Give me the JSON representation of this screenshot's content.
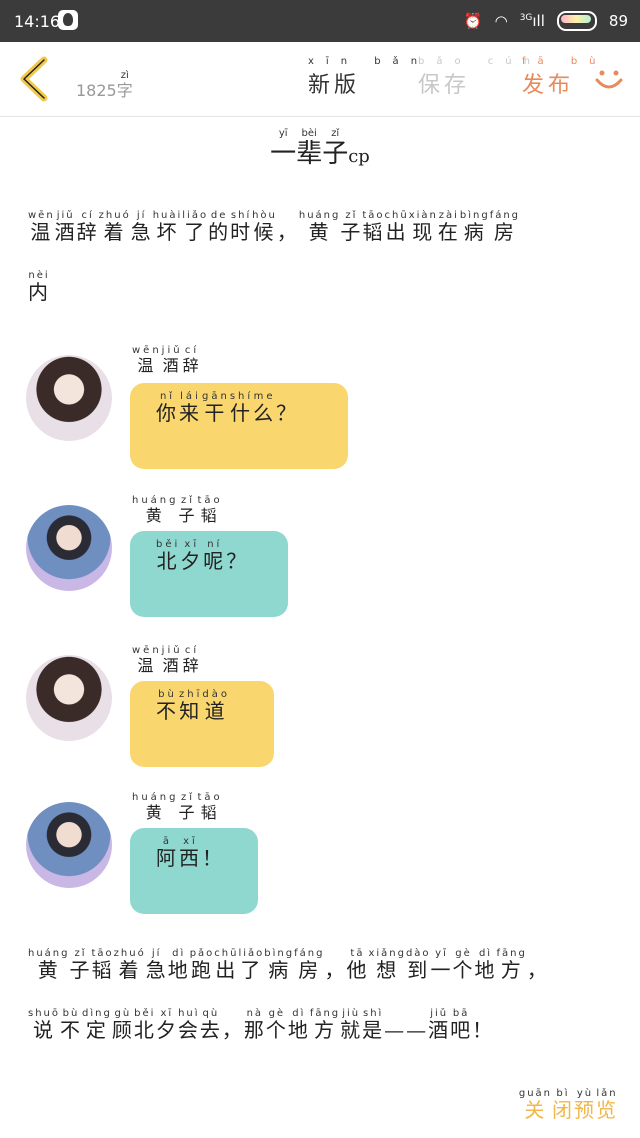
{
  "status_bar": {
    "time": "14:16",
    "signal": "3G",
    "battery": "89"
  },
  "toolbar": {
    "word_count": "1825",
    "word_unit": "字",
    "word_unit_py": "zì",
    "new_version": "新版",
    "new_version_py": "xīn bǎn",
    "save": "保存",
    "save_py": "bǎo cún",
    "publish": "发布",
    "publish_py": "fā bù"
  },
  "title": {
    "text": [
      [
        "一",
        "yī"
      ],
      [
        "辈",
        "bèi"
      ],
      [
        "子",
        "zǐ"
      ]
    ],
    "suffix": "cp"
  },
  "para1": {
    "line1": [
      [
        "温",
        "wēn"
      ],
      [
        "酒",
        "jiǔ"
      ],
      [
        "辞",
        "cí"
      ],
      [
        "着",
        "zhuó"
      ],
      [
        "急",
        "jí"
      ],
      [
        "坏",
        "huài"
      ],
      [
        "了",
        "liǎo"
      ],
      [
        "的",
        "de"
      ],
      [
        "时",
        "shí"
      ],
      [
        "候",
        "hòu"
      ],
      [
        "，",
        ""
      ],
      [
        "黄",
        "huáng"
      ],
      [
        "子",
        "zǐ"
      ],
      [
        "韬",
        "tāo"
      ],
      [
        "出",
        "chū"
      ],
      [
        "现",
        "xiàn"
      ],
      [
        "在",
        "zài"
      ],
      [
        "病",
        "bìng"
      ],
      [
        "房",
        "fáng"
      ]
    ],
    "line2": [
      [
        "内",
        "nèi"
      ]
    ]
  },
  "messages": [
    {
      "sender": [
        [
          "温",
          "wēn"
        ],
        [
          "酒",
          "jiǔ"
        ],
        [
          "辞",
          "cí"
        ]
      ],
      "text": [
        [
          "你",
          "nǐ"
        ],
        [
          "来",
          "lái"
        ],
        [
          "干",
          "gān"
        ],
        [
          "什",
          "shí"
        ],
        [
          "么",
          "me"
        ],
        [
          "？",
          ""
        ]
      ],
      "color": "#f9d66e",
      "avatar": "female-avatar"
    },
    {
      "sender": [
        [
          "黄",
          "huáng"
        ],
        [
          "子",
          "zǐ"
        ],
        [
          "韬",
          "tāo"
        ]
      ],
      "text": [
        [
          "北",
          "běi"
        ],
        [
          "夕",
          "xī"
        ],
        [
          "呢",
          "ní"
        ],
        [
          "？",
          ""
        ]
      ],
      "color": "#8ed8cf",
      "avatar": "male-avatar"
    },
    {
      "sender": [
        [
          "温",
          "wēn"
        ],
        [
          "酒",
          "jiǔ"
        ],
        [
          "辞",
          "cí"
        ]
      ],
      "text": [
        [
          "不",
          "bù"
        ],
        [
          "知",
          "zhī"
        ],
        [
          "道",
          "dào"
        ]
      ],
      "color": "#f9d66e",
      "avatar": "female-avatar"
    },
    {
      "sender": [
        [
          "黄",
          "huáng"
        ],
        [
          "子",
          "zǐ"
        ],
        [
          "韬",
          "tāo"
        ]
      ],
      "text": [
        [
          "阿",
          "ā"
        ],
        [
          "西",
          "xī"
        ],
        [
          "！",
          ""
        ]
      ],
      "color": "#8ed8cf",
      "avatar": "male-avatar"
    }
  ],
  "para2": {
    "line1": [
      [
        "黄",
        "huáng"
      ],
      [
        "子",
        "zǐ"
      ],
      [
        "韬",
        "tāo"
      ],
      [
        "着",
        "zhuó"
      ],
      [
        "急",
        "jí"
      ],
      [
        "地",
        "dì"
      ],
      [
        "跑",
        "pǎo"
      ],
      [
        "出",
        "chū"
      ],
      [
        "了",
        "liǎo"
      ],
      [
        "病",
        "bìng"
      ],
      [
        "房",
        "fáng"
      ],
      [
        "，",
        ""
      ],
      [
        "他",
        "tā"
      ],
      [
        "想",
        "xiǎng"
      ],
      [
        "到",
        "dào"
      ],
      [
        "一",
        "yī"
      ],
      [
        "个",
        "gè"
      ],
      [
        "地",
        "dì"
      ],
      [
        "方",
        "fāng"
      ],
      [
        "，",
        ""
      ]
    ],
    "line2": [
      [
        "说",
        "shuō"
      ],
      [
        "不",
        "bù"
      ],
      [
        "定",
        "dìng"
      ],
      [
        "顾",
        "gù"
      ],
      [
        "北",
        "běi"
      ],
      [
        "夕",
        "xī"
      ],
      [
        "会",
        "huì"
      ],
      [
        "去",
        "qù"
      ],
      [
        "，",
        ""
      ],
      [
        "那",
        "nà"
      ],
      [
        "个",
        "gè"
      ],
      [
        "地",
        "dì"
      ],
      [
        "方",
        "fāng"
      ],
      [
        "就",
        "jiù"
      ],
      [
        "是",
        "shì"
      ],
      [
        "——",
        ""
      ],
      [
        "酒",
        "jiǔ"
      ],
      [
        "吧",
        "bā"
      ],
      [
        "！",
        ""
      ]
    ]
  },
  "close_preview": {
    "text": [
      [
        "关",
        "guān"
      ],
      [
        "闭",
        "bì"
      ],
      [
        "预",
        "yù"
      ],
      [
        "览",
        "lǎn"
      ]
    ]
  },
  "colors": {
    "accent_publish": "#e88a5a",
    "close_preview": "#f2b64a",
    "bubble_yellow": "#f9d66e",
    "bubble_teal": "#8ed8cf"
  }
}
